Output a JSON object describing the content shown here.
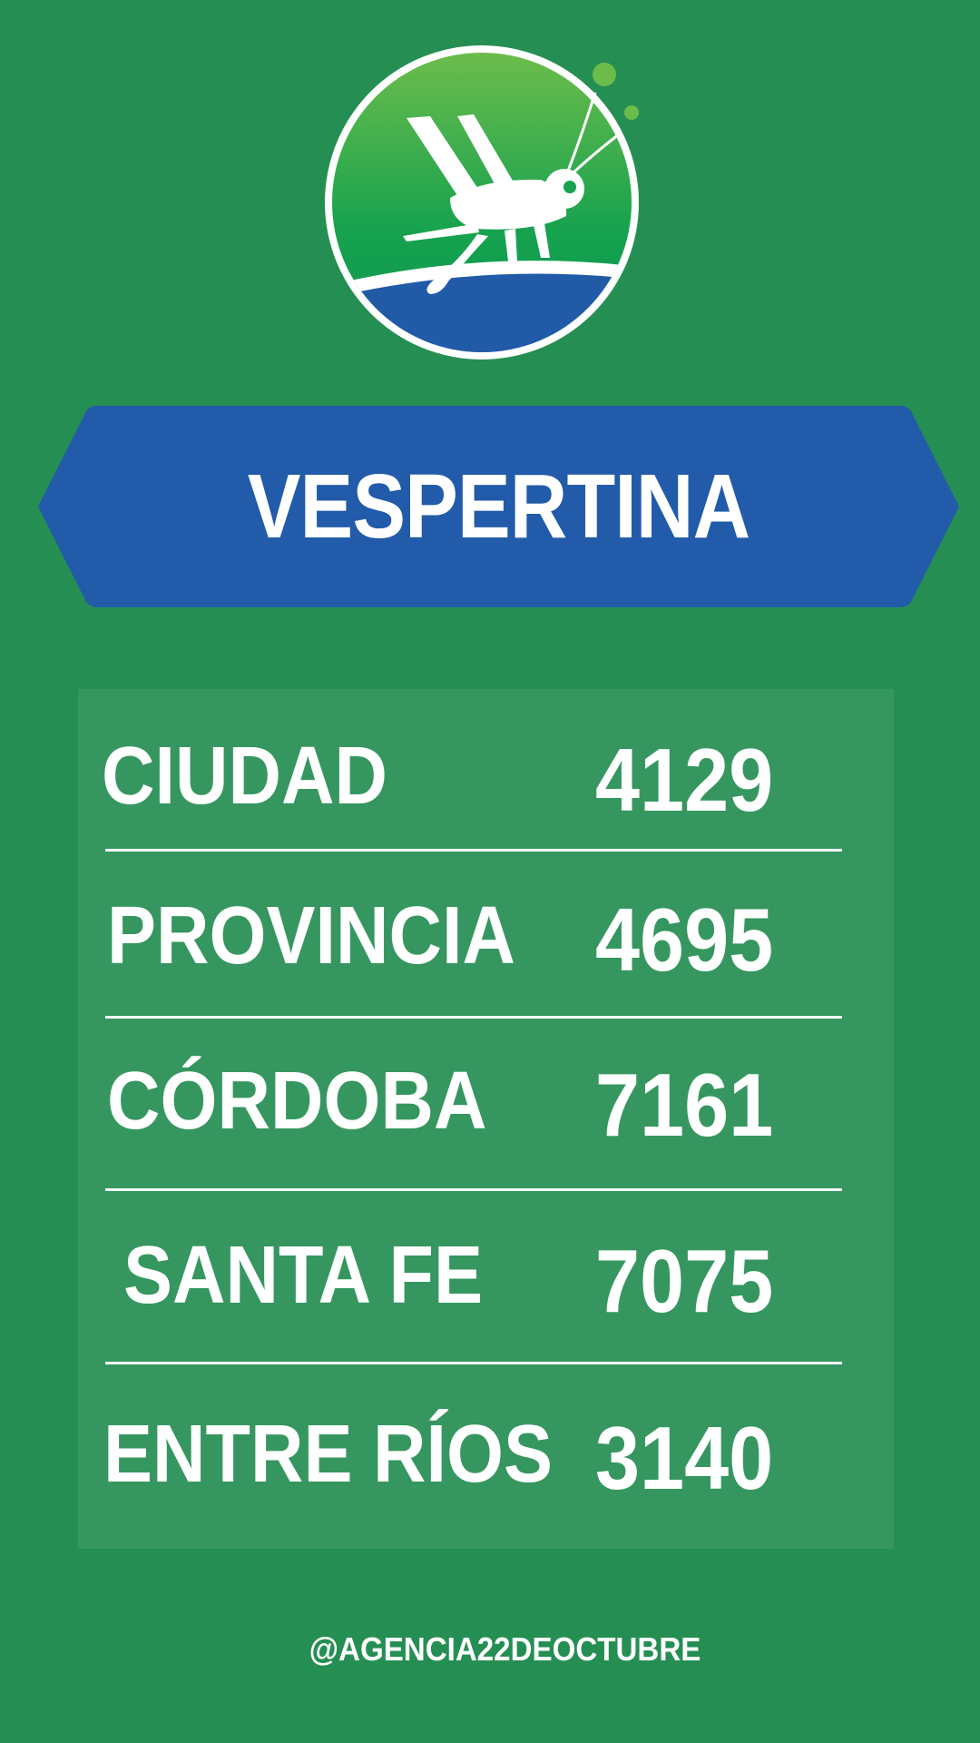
{
  "header": {
    "logo_icon": "grasshopper-logo-icon"
  },
  "banner": {
    "title": "VESPERTINA"
  },
  "results": [
    {
      "name": "CIUDAD",
      "value": "4129"
    },
    {
      "name": "PROVINCIA",
      "value": "4695"
    },
    {
      "name": "CÓRDOBA",
      "value": "7161"
    },
    {
      "name": "SANTA FE",
      "value": "7075"
    },
    {
      "name": "ENTRE RÍOS",
      "value": "3140"
    }
  ],
  "footer": {
    "handle": "@AGENCIA22DEOCTUBRE"
  },
  "colors": {
    "background": "#258f53",
    "panel": "#35975f",
    "banner": "#225ba9",
    "text": "#ffffff"
  }
}
